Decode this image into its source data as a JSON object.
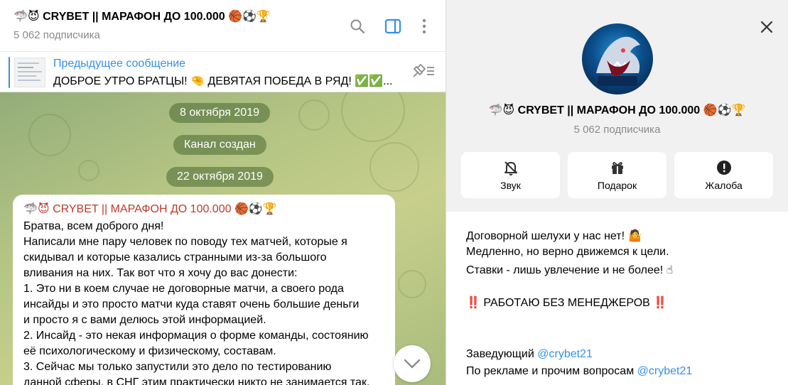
{
  "header": {
    "title_emoji": "🦈😈",
    "title": "CRYBET || МАРАФОН ДО 100.000",
    "title_trail": "🏀⚽🏆",
    "subscribers": "5 062 подписчика"
  },
  "header_icons": [
    "search-icon",
    "sidebar-toggle-icon",
    "more-vertical-icon"
  ],
  "pinned": {
    "title": "Предыдущее сообщение",
    "text": "ДОБРОЕ УТРО БРАТЦЫ! 🤏 ДЕВЯТАЯ ПОБЕДА В РЯД! ✅✅..."
  },
  "dates": {
    "first": "8 октября 2019",
    "channel_created": "Канал создан",
    "second": "22 октября 2019"
  },
  "message": {
    "author_emoji": "🦈😈",
    "author": "CRYBET || МАРАФОН ДО 100.000",
    "author_trail": "🏀⚽🏆",
    "lines": [
      "Братва, всем доброго дня!",
      "Написали мне пару человек по поводу тех матчей, которые я",
      "скидывал и которые казались странными из-за большого",
      "вливания на них. Так вот что я хочу до вас донести:",
      "1. Это ни в коем случае не договорные матчи, а своего рода",
      "инсайды и это просто матчи куда ставят очень большие деньги",
      "и просто я с вами делюсь этой информацией.",
      "2. Инсайд - это некая информация о форме команды, состоянию",
      "её психологическому и физическому, составам.",
      "3. Сейчас мы только запустили это дело по тестированию",
      "данной сферы, в СНГ этим практически никто не занимается так."
    ]
  },
  "info": {
    "title_emoji": "🦈😈",
    "title": "CRYBET || МАРАФОН ДО 100.000",
    "title_trail": "🏀⚽🏆",
    "subscribers": "5 062 подписчика",
    "actions": [
      {
        "label": "Звук",
        "icon": "bell-off-icon"
      },
      {
        "label": "Подарок",
        "icon": "gift-icon"
      },
      {
        "label": "Жалоба",
        "icon": "report-icon"
      }
    ],
    "about": {
      "line1": "Договорной шелухи у нас нет! 🤷",
      "line2": "Медленно, но верно движемся к цели.",
      "line3": "Ставки - лишь увлечение и не более! ☝",
      "line4": "‼️ РАБОТАЮ БЕЗ МЕНЕДЖЕРОВ ‼️",
      "manager_label": "Заведующий",
      "manager_link": "@crybet21",
      "ads_label": "По рекламе и прочим вопросам",
      "ads_link": "@crybet21"
    }
  },
  "colors": {
    "accent": "#3390ec",
    "author": "#c0392b",
    "wallpaper": "#b5c584",
    "date_chip": "#6b8a4a",
    "report": "#000000"
  }
}
